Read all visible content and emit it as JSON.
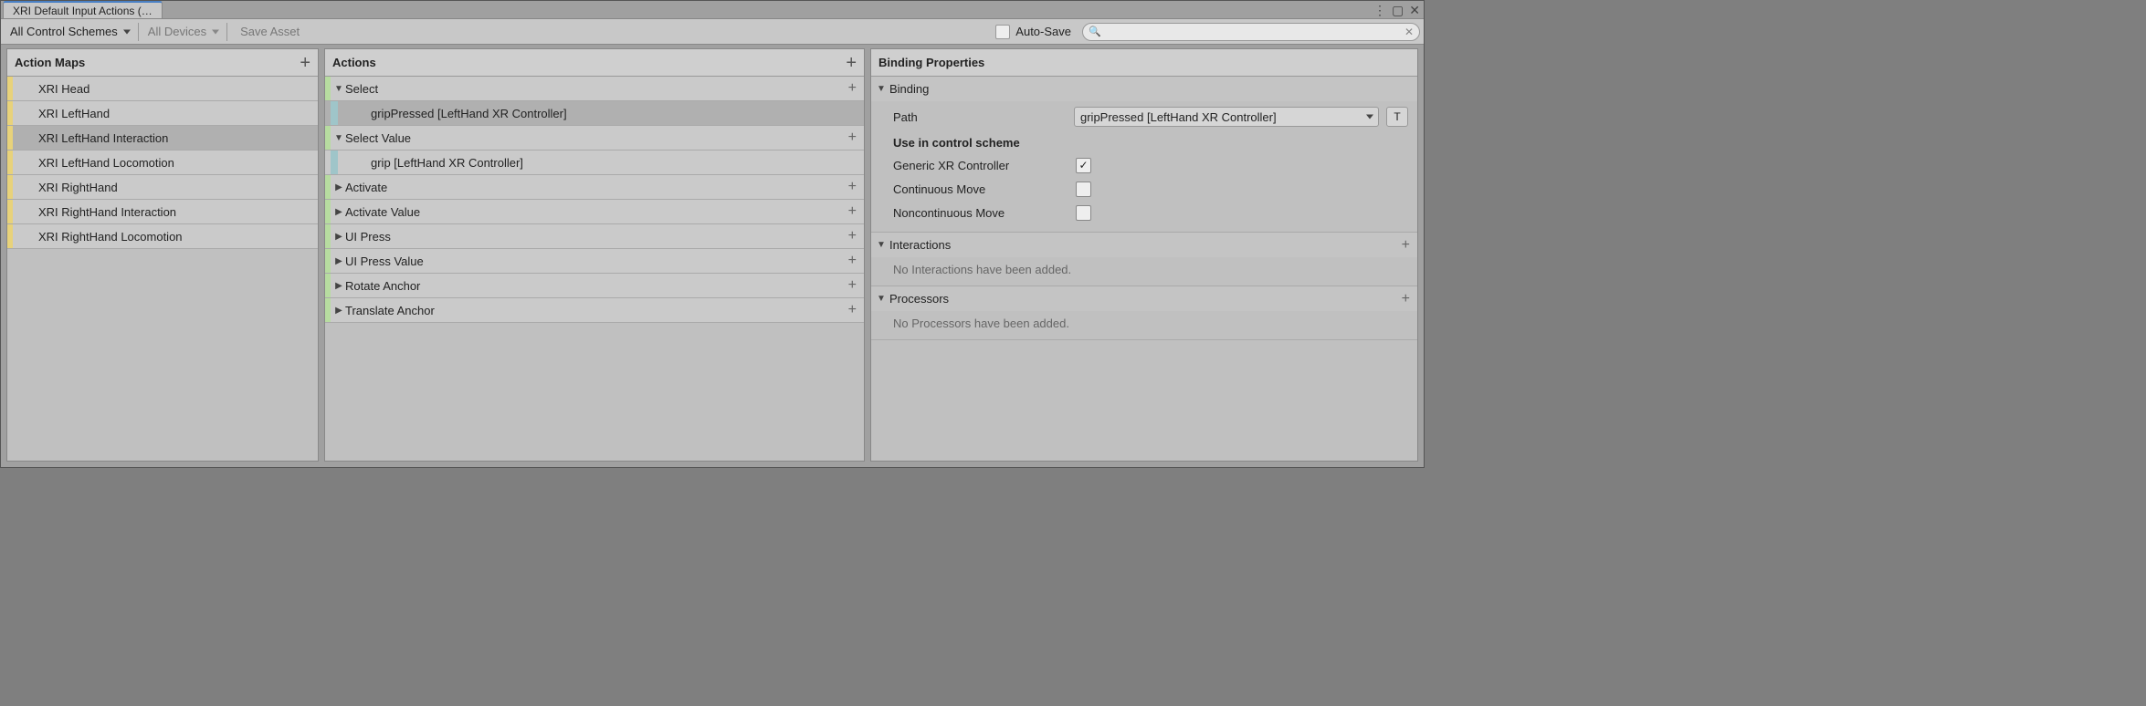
{
  "window": {
    "title": "XRI Default Input Actions (…"
  },
  "toolbar": {
    "schemes_label": "All Control Schemes",
    "devices_label": "All Devices",
    "save_label": "Save Asset",
    "autosave_label": "Auto-Save",
    "search_placeholder": ""
  },
  "panels": {
    "action_maps_title": "Action Maps",
    "actions_title": "Actions",
    "binding_props_title": "Binding Properties"
  },
  "action_maps": [
    {
      "label": "XRI Head",
      "selected": false
    },
    {
      "label": "XRI LeftHand",
      "selected": false
    },
    {
      "label": "XRI LeftHand Interaction",
      "selected": true
    },
    {
      "label": "XRI LeftHand Locomotion",
      "selected": false
    },
    {
      "label": "XRI RightHand",
      "selected": false
    },
    {
      "label": "XRI RightHand Interaction",
      "selected": false
    },
    {
      "label": "XRI RightHand Locomotion",
      "selected": false
    }
  ],
  "actions": [
    {
      "label": "Select",
      "expanded": true,
      "children": [
        {
          "label": "gripPressed [LeftHand XR Controller]",
          "selected": true
        }
      ]
    },
    {
      "label": "Select Value",
      "expanded": true,
      "children": [
        {
          "label": "grip [LeftHand XR Controller]",
          "selected": false
        }
      ]
    },
    {
      "label": "Activate",
      "expanded": false
    },
    {
      "label": "Activate Value",
      "expanded": false
    },
    {
      "label": "UI Press",
      "expanded": false
    },
    {
      "label": "UI Press Value",
      "expanded": false
    },
    {
      "label": "Rotate Anchor",
      "expanded": false
    },
    {
      "label": "Translate Anchor",
      "expanded": false
    }
  ],
  "binding": {
    "section_label": "Binding",
    "path_label": "Path",
    "path_value": "gripPressed [LeftHand XR Controller]",
    "t_button": "T",
    "use_scheme_label": "Use in control scheme",
    "schemes": [
      {
        "label": "Generic XR Controller",
        "checked": true
      },
      {
        "label": "Continuous Move",
        "checked": false
      },
      {
        "label": "Noncontinuous Move",
        "checked": false
      }
    ]
  },
  "interactions": {
    "section_label": "Interactions",
    "empty_msg": "No Interactions have been added."
  },
  "processors": {
    "section_label": "Processors",
    "empty_msg": "No Processors have been added."
  }
}
